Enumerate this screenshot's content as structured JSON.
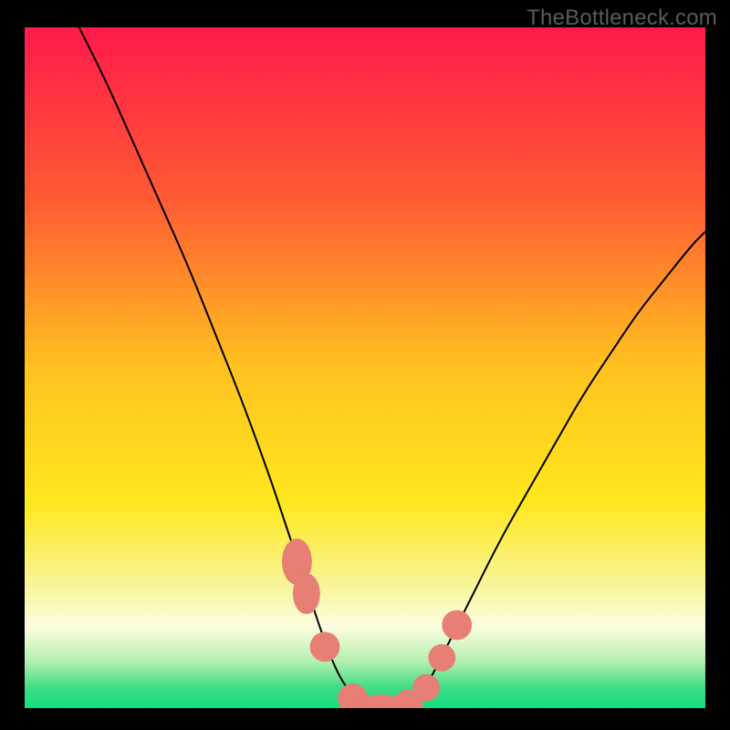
{
  "attribution": "TheBottleneck.com",
  "chart_data": {
    "type": "line",
    "title": "",
    "xlabel": "",
    "ylabel": "",
    "xlim": [
      0,
      100
    ],
    "ylim": [
      0,
      100
    ],
    "background_gradient": {
      "stops": [
        {
          "pos": 0.0,
          "color": "#ff1a4b"
        },
        {
          "pos": 0.25,
          "color": "#ff5a33"
        },
        {
          "pos": 0.5,
          "color": "#ffc21f"
        },
        {
          "pos": 0.7,
          "color": "#ffe81f"
        },
        {
          "pos": 0.82,
          "color": "#f8f59a"
        },
        {
          "pos": 0.88,
          "color": "#fdfde0"
        },
        {
          "pos": 0.93,
          "color": "#b7f0b0"
        },
        {
          "pos": 0.97,
          "color": "#3fdc86"
        },
        {
          "pos": 1.0,
          "color": "#11e07f"
        }
      ]
    },
    "series": [
      {
        "name": "bottleneck-curve",
        "color": "#000000",
        "x": [
          8,
          12,
          16,
          20,
          24,
          28,
          32,
          36,
          38,
          40,
          42,
          44,
          46,
          48,
          50,
          52,
          54,
          56,
          58,
          60,
          62,
          66,
          70,
          74,
          78,
          82,
          86,
          90,
          94,
          98,
          100
        ],
        "y": [
          100,
          92,
          83,
          74,
          65,
          55,
          45,
          34,
          28,
          22,
          16,
          10,
          5,
          2,
          0.5,
          0,
          0,
          0.5,
          2,
          5,
          9,
          17,
          25,
          32,
          39,
          46,
          52,
          58,
          63,
          68,
          70
        ]
      }
    ],
    "markers": {
      "color": "#e77f74",
      "points": [
        {
          "x": 40.0,
          "y": 21.5,
          "rx": 2.2,
          "ry": 3.4
        },
        {
          "x": 41.4,
          "y": 16.8,
          "rx": 2.0,
          "ry": 3.0
        },
        {
          "x": 44.1,
          "y": 9.0,
          "rx": 2.2,
          "ry": 2.2
        },
        {
          "x": 48.2,
          "y": 1.4,
          "rx": 2.2,
          "ry": 2.2
        },
        {
          "x": 52.3,
          "y": 0.1,
          "rx": 4.0,
          "ry": 1.9
        },
        {
          "x": 56.3,
          "y": 0.5,
          "rx": 2.2,
          "ry": 2.2
        },
        {
          "x": 59.0,
          "y": 3.0,
          "rx": 2.0,
          "ry": 2.0
        },
        {
          "x": 61.3,
          "y": 7.4,
          "rx": 2.0,
          "ry": 2.0
        },
        {
          "x": 63.5,
          "y": 12.2,
          "rx": 2.2,
          "ry": 2.2
        }
      ]
    }
  }
}
